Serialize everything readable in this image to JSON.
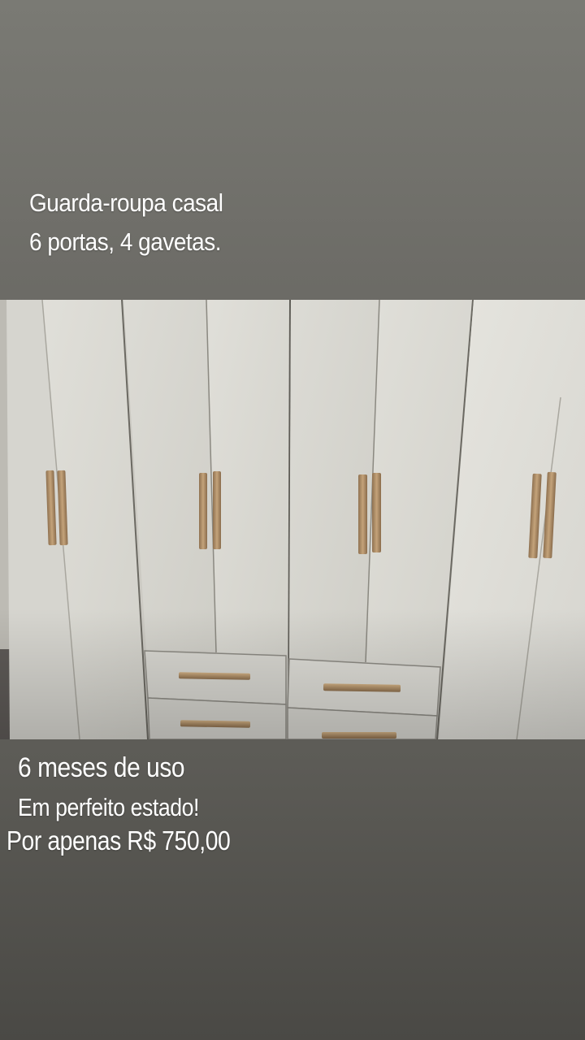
{
  "story": {
    "header_line1": "Guarda-roupa casal",
    "header_line2": "6 portas, 4 gavetas.",
    "footer_line1": "6 meses de uso",
    "footer_line2": "Em perfeito estado!",
    "footer_line3": "Por apenas R$ 750,00"
  },
  "photo": {
    "subject": "white six-door wardrobe with four drawers and gold handles",
    "colors": {
      "wardrobe": "#d9d8d2",
      "handle": "#b8976c",
      "background_top": "#7a7a74",
      "background_bottom": "#4a4945"
    }
  }
}
